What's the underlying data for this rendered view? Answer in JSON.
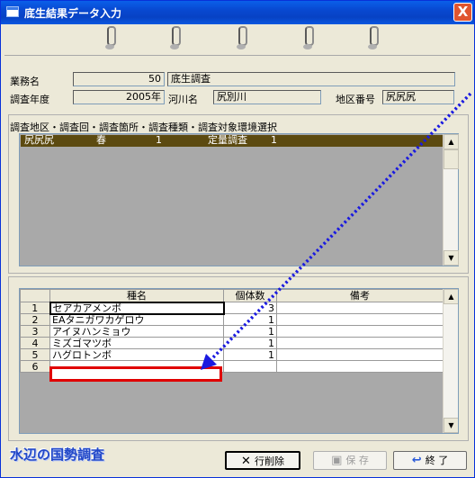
{
  "window": {
    "title": "底生結果データ入力",
    "close_label": "X"
  },
  "form": {
    "gyomu_label": "業務名",
    "gyomu_no": "50",
    "gyomu_name": "底生調査",
    "nendo_label": "調査年度",
    "nendo_value": "2005年",
    "kasen_label": "河川名",
    "kasen_value": "尻別川",
    "chiku_label": "地区番号",
    "chiku_value": "尻尻尻"
  },
  "selection": {
    "label": "調査地区・調査回・調査箇所・調査種類・調査対象環境選択",
    "rows": [
      {
        "chiku": "尻尻尻",
        "kai": "春",
        "kasho": "1",
        "shurui": "定量調査",
        "kankyo": "1"
      }
    ]
  },
  "grid": {
    "headers": {
      "name": "種名",
      "count": "個体数",
      "note": "備考"
    },
    "rows": [
      {
        "no": "1",
        "name": "セアカアメンボ",
        "count": "3",
        "note": ""
      },
      {
        "no": "2",
        "name": "EAタニガワカゲロウ",
        "count": "1",
        "note": ""
      },
      {
        "no": "3",
        "name": "アイヌハンミョウ",
        "count": "1",
        "note": ""
      },
      {
        "no": "4",
        "name": "ミズゴマツボ",
        "count": "1",
        "note": ""
      },
      {
        "no": "5",
        "name": "ハグロトンボ",
        "count": "1",
        "note": ""
      },
      {
        "no": "6",
        "name": "",
        "count": "",
        "note": ""
      }
    ]
  },
  "footer": {
    "brand": "水辺の国勢調査",
    "delete_label": "行削除",
    "save_label": "保 存",
    "exit_label": "終 了"
  },
  "colors": {
    "titlebar": "#0848d0",
    "selected_row": "#5c4a10",
    "highlight_box": "#e00000",
    "arrow": "#1a1ae0",
    "brand": "#2248c8"
  },
  "icons": {
    "delete": "x-icon",
    "save": "floppy-disk-icon",
    "exit": "exit-arrow-icon",
    "scroll_up": "triangle-up-icon",
    "scroll_down": "triangle-down-icon"
  }
}
